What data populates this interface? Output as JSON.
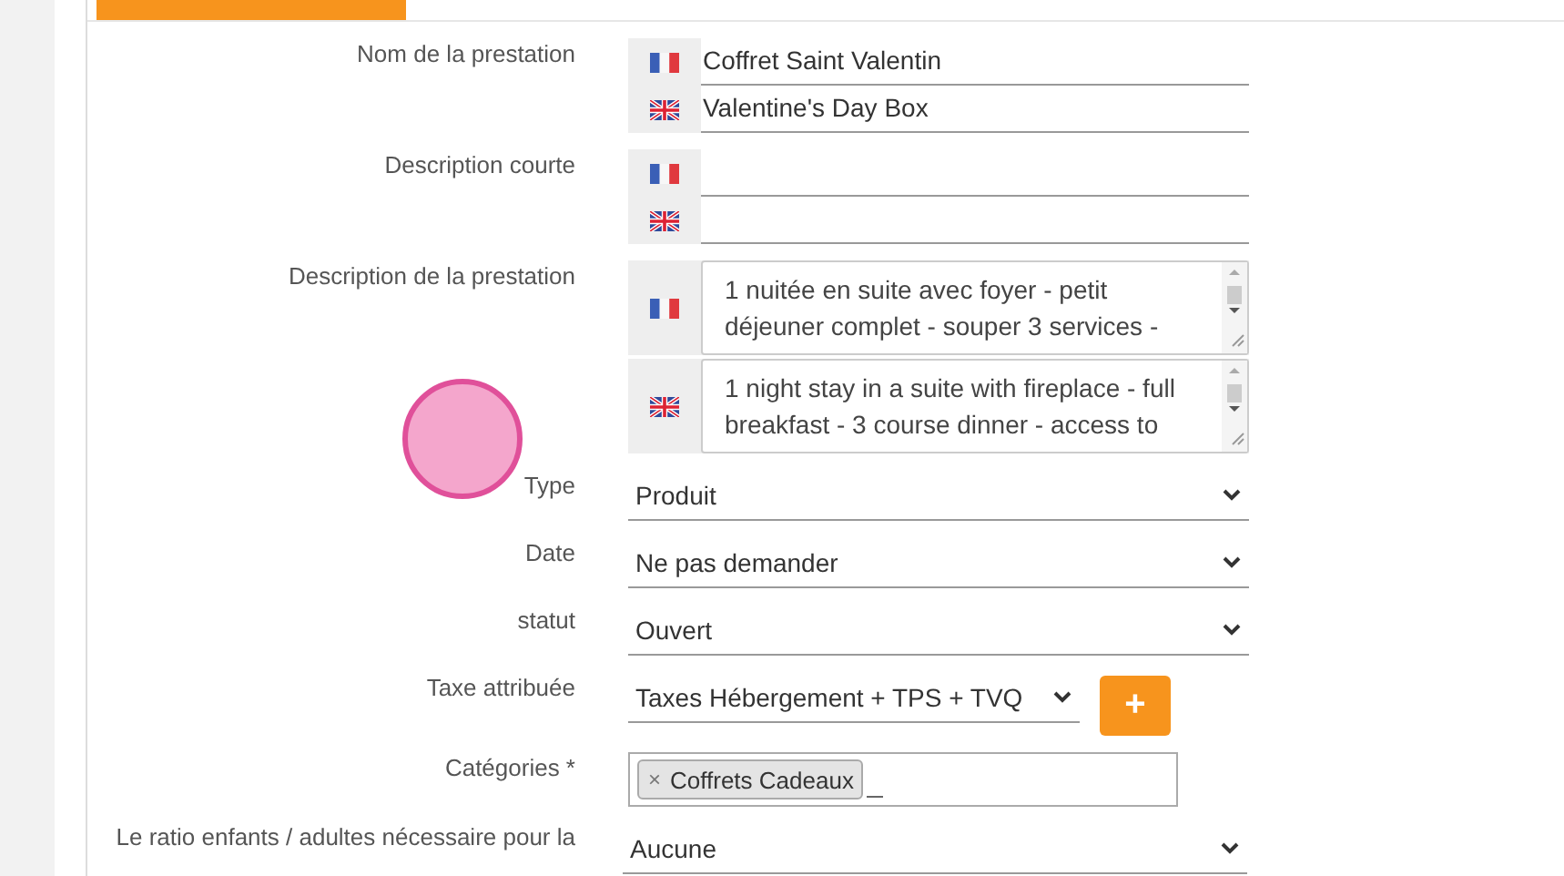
{
  "tabs": [
    {
      "selected": true
    }
  ],
  "fields": [
    {
      "kind": "multilang",
      "label": "Nom de la prestation",
      "values": [
        {
          "kind": "fr",
          "value": "Coffret Saint Valentin"
        },
        {
          "kind": "en",
          "value": "Valentine's Day Box"
        }
      ]
    },
    {
      "kind": "multilang",
      "label": "Description courte",
      "values": [
        {
          "kind": "fr"
        },
        {
          "kind": "en"
        }
      ]
    },
    {
      "kind": "multitext",
      "label": "Description de la prestation",
      "values": [
        {
          "kind": "fr",
          "value": "1 nuitée en suite avec foyer - petit déjeuner complet - souper 3 services -"
        },
        {
          "kind": "en",
          "value": "1 night stay in a suite with fireplace - full breakfast - 3 course dinner - access to"
        }
      ]
    },
    {
      "kind": "select",
      "label": "Type",
      "value": "Produit"
    },
    {
      "kind": "select",
      "label": "Date",
      "value": "Ne pas demander"
    },
    {
      "kind": "select",
      "label": "statut",
      "value": "Ouvert"
    },
    {
      "kind": "select_add",
      "label": "Taxe attribuée",
      "value": "Taxes Hébergement + TPS + TVQ",
      "button": "+"
    },
    {
      "kind": "tags",
      "label": "Catégories *",
      "tags": [
        {
          "label": "Coffrets Cadeaux",
          "remove": "×"
        }
      ]
    },
    {
      "kind": "select_wide",
      "label": "Le ratio enfants / adultes nécessaire pour la",
      "value": "Aucune"
    }
  ]
}
